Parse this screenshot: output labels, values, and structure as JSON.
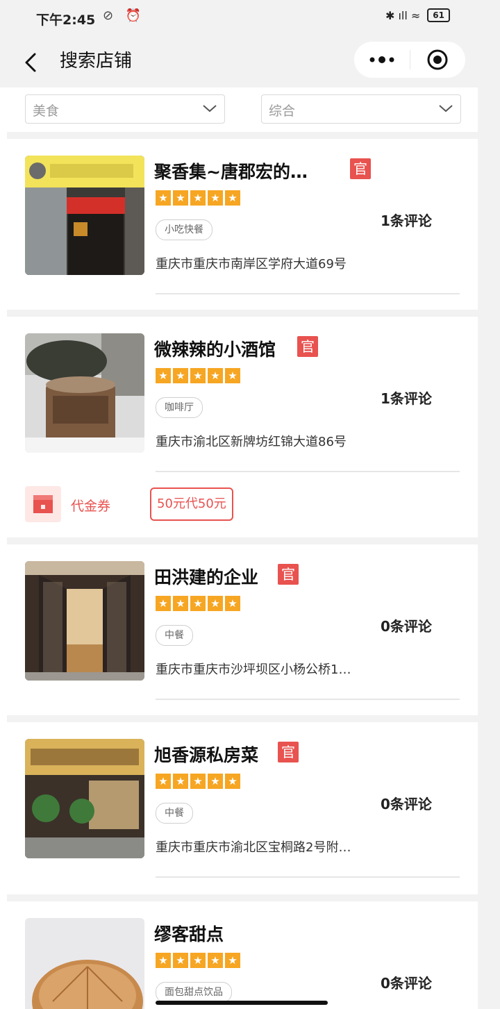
{
  "status_bar": {
    "time": "下午2:45",
    "left_icons": "⊘ ⏰",
    "right_signal": "✱ ıll ≈",
    "battery": "61"
  },
  "nav": {
    "title": "搜索店铺"
  },
  "filters": {
    "category": "美食",
    "sort": "综合"
  },
  "shops": [
    {
      "name": "聚香集~唐郡宏的…",
      "official_badge": "官",
      "category": "小吃快餐",
      "address": "重庆市重庆市南岸区学府大道69号",
      "reviews": "1条评论",
      "rating": 5
    },
    {
      "name": "微辣辣的小酒馆",
      "official_badge": "官",
      "category": "咖啡厅",
      "address": "重庆市渝北区新牌坊红锦大道86号",
      "reviews": "1条评论",
      "rating": 5
    },
    {
      "name": "田洪建的企业",
      "official_badge": "官",
      "category": "中餐",
      "address": "重庆市重庆市沙坪坝区小杨公桥1…",
      "reviews": "0条评论",
      "rating": 5
    },
    {
      "name": "旭香源私房菜",
      "official_badge": "官",
      "category": "中餐",
      "address": "重庆市重庆市渝北区宝桐路2号附…",
      "reviews": "0条评论",
      "rating": 5
    },
    {
      "name": "缪客甜点",
      "category": "面包甜点饮品",
      "reviews": "0条评论",
      "rating": 5
    }
  ],
  "voucher": {
    "label": "代金券",
    "offer": "50元代50元"
  },
  "colors": {
    "official_badge": "#e8524f",
    "star": "#f6a623",
    "voucher": "#e8524f",
    "background": "#f2f2f2"
  },
  "icons": {
    "back": "chevron-left-icon",
    "more": "more-dots-icon",
    "close": "target-close-icon",
    "dropdown": "chevron-down-icon",
    "voucher": "gift-coupon-icon",
    "star": "star-icon"
  }
}
